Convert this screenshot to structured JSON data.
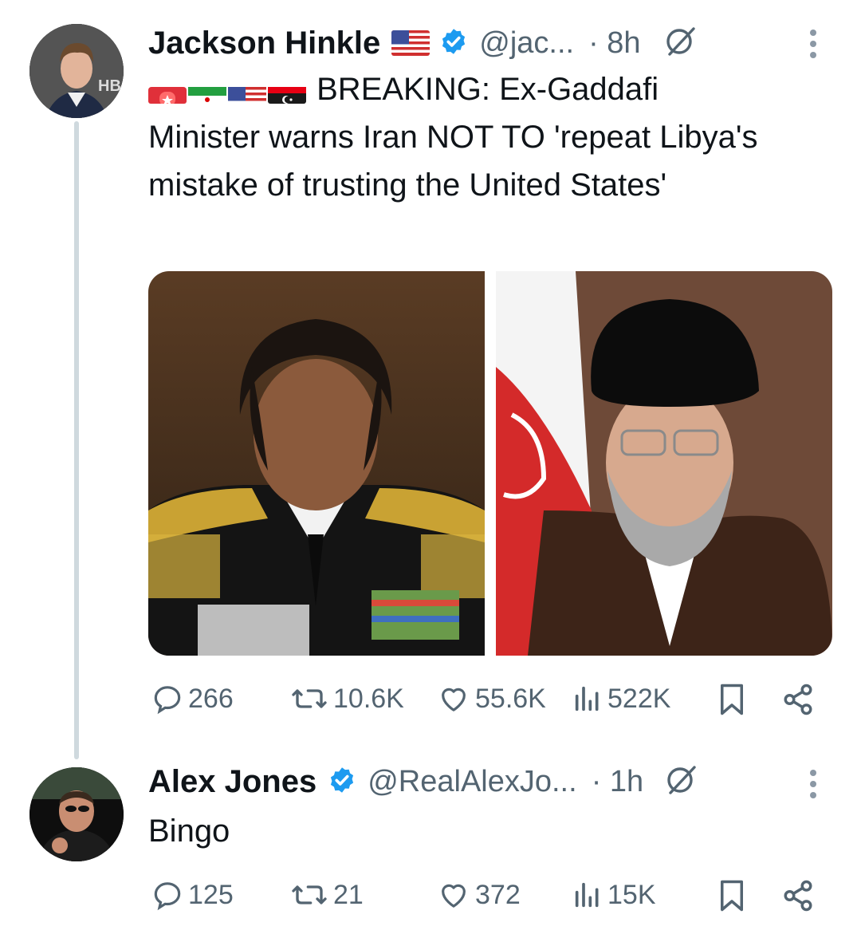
{
  "tweet": {
    "author_name": "Jackson Hinkle",
    "author_handle": "@jac...",
    "time": "· 8h",
    "text_prefix_icons": [
      "rotating-light-icon",
      "iran-flag-icon",
      "us-flag-icon",
      "libya-flag-icon"
    ],
    "text": "BREAKING: Ex-Gaddafi Minister warns Iran NOT TO 'repeat Libya's mistake of trusting the United States'",
    "images": [
      "Muammar Gaddafi in military uniform",
      "Iranian cleric in black turban"
    ],
    "stats": {
      "replies": "266",
      "reposts": "10.6K",
      "likes": "55.6K",
      "views": "522K"
    },
    "avatar_text": "HB"
  },
  "reply": {
    "author_name": "Alex Jones",
    "author_handle": "@RealAlexJo...",
    "time": "· 1h",
    "text": "Bingo",
    "stats": {
      "replies": "125",
      "reposts": "21",
      "likes": "372",
      "views": "15K"
    }
  },
  "colors": {
    "verified": "#1d9bf0",
    "muted": "#536471",
    "thread_line": "#cfd9de"
  }
}
